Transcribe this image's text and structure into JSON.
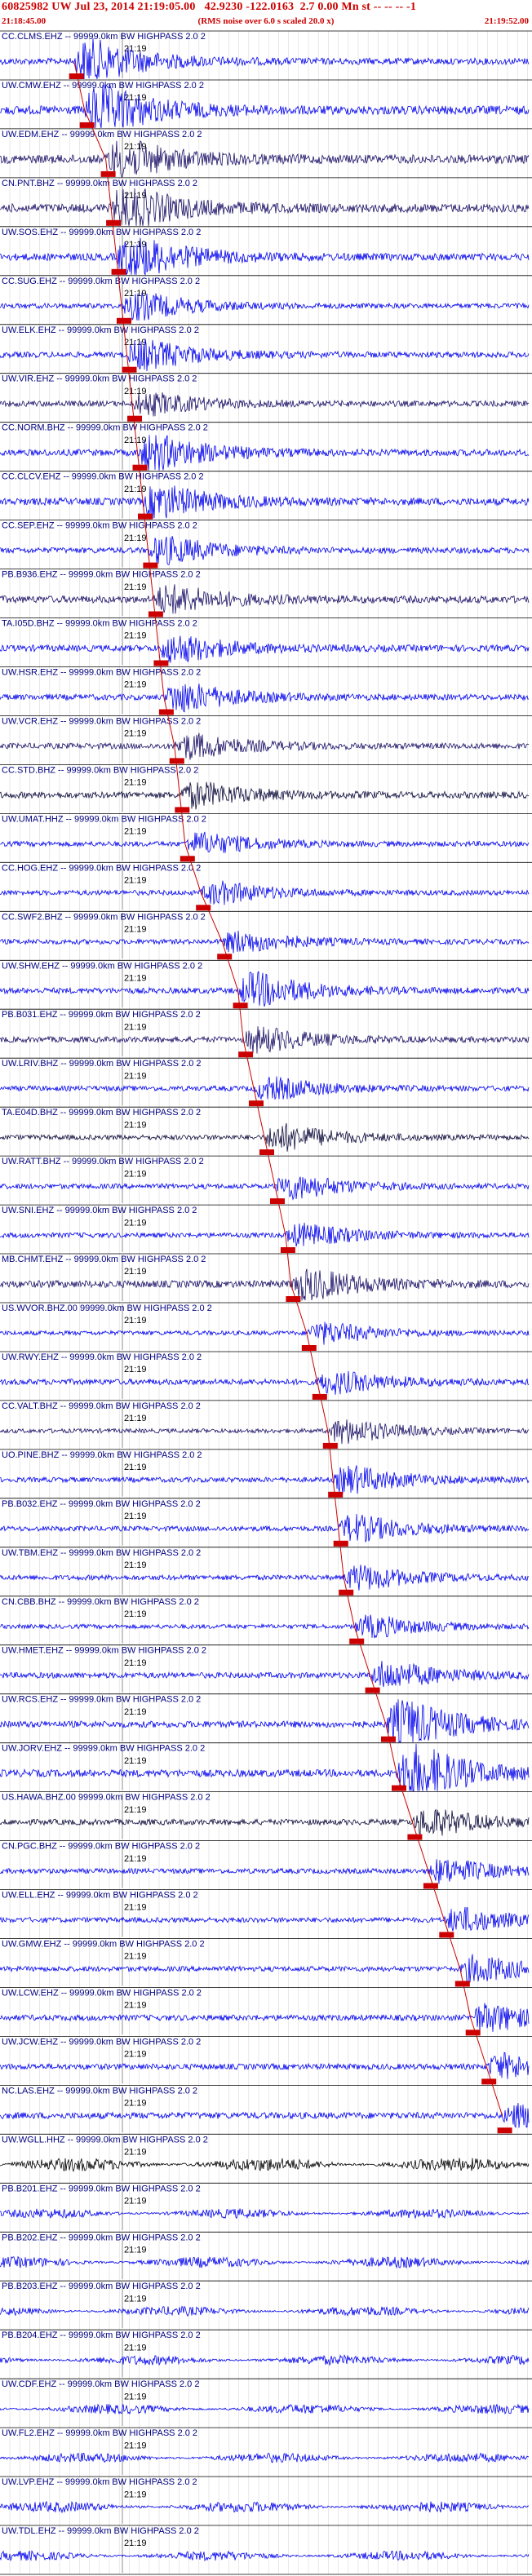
{
  "header": {
    "title": "60825982 UW Jul 23, 2014 21:19:05.00   42.9230 -122.0163  2.7 0.00 Mn st -- -- -- -1",
    "start_time": "21:18:45.00",
    "end_time": "21:19:52.00",
    "subtitle": "(RMS noise over 6.0 s scaled 20.0 x)"
  },
  "colors": {
    "trace": "#0000ee",
    "trace_dark": "#1a1066",
    "trace_darker": "#0b0a3a",
    "trace_black": "#000000",
    "pick_line": "#cc0000",
    "flag": "#cc0000",
    "label": "#000080"
  },
  "time_label": "21:19",
  "chart_data": {
    "type": "seismogram-stack",
    "x_axis": {
      "start": "21:18:45.00",
      "end": "21:19:52.00",
      "tick_label": "21:19"
    },
    "traces": [
      {
        "label": "CC.CLMS.EHZ -- 99999.0km BW  HIGHPASS  2.0  2",
        "color": "trace",
        "event_start": 0.14,
        "envelope": 0.45,
        "burst": 1.6
      },
      {
        "label": "UW.CMW.EHZ -- 99999.0km BW  HIGHPASS  2.0  2",
        "color": "trace",
        "event_start": 0.16,
        "envelope": 0.6,
        "burst": 1.8
      },
      {
        "label": "UW.EDM.EHZ -- 99999.0km BW  HIGHPASS  2.0  2",
        "color": "trace_dark",
        "event_start": 0.2,
        "envelope": 0.6,
        "burst": 1.4
      },
      {
        "label": "CN.PNT.BHZ -- 99999.0km BW  HIGHPASS  2.0  2",
        "color": "trace_dark",
        "event_start": 0.21,
        "envelope": 0.6,
        "burst": 1.5
      },
      {
        "label": "UW.SOS.EHZ -- 99999.0km BW  HIGHPASS  2.0  2",
        "color": "trace",
        "event_start": 0.22,
        "envelope": 0.5,
        "burst": 1.6
      },
      {
        "label": "CC.SUG.EHZ -- 99999.0km BW  HIGHPASS  2.0  2",
        "color": "trace",
        "event_start": 0.23,
        "envelope": 0.35,
        "burst": 1.0
      },
      {
        "label": "UW.ELK.EHZ -- 99999.0km BW  HIGHPASS  2.0  2",
        "color": "trace",
        "event_start": 0.24,
        "envelope": 0.4,
        "burst": 1.1
      },
      {
        "label": "UW.VIR.EHZ -- 99999.0km BW  HIGHPASS  2.0  2",
        "color": "trace_dark",
        "event_start": 0.25,
        "envelope": 0.4,
        "burst": 0.8
      },
      {
        "label": "CC.NORM.BHZ -- 99999.0km BW  HIGHPASS  2.0  2",
        "color": "trace",
        "event_start": 0.26,
        "envelope": 0.45,
        "burst": 1.3
      },
      {
        "label": "CC.CLCV.EHZ -- 99999.0km BW  HIGHPASS  2.0  2",
        "color": "trace",
        "event_start": 0.27,
        "envelope": 0.5,
        "burst": 1.2
      },
      {
        "label": "CC.SEP.EHZ -- 99999.0km BW  HIGHPASS  2.0  2",
        "color": "trace",
        "event_start": 0.28,
        "envelope": 0.4,
        "burst": 1.0
      },
      {
        "label": "PB.B936.EHZ -- 99999.0km BW  HIGHPASS  2.0  2",
        "color": "trace_dark",
        "event_start": 0.29,
        "envelope": 0.5,
        "burst": 1.0
      },
      {
        "label": "TA.I05D.BHZ -- 99999.0km BW  HIGHPASS  2.0  2",
        "color": "trace",
        "event_start": 0.3,
        "envelope": 0.45,
        "burst": 1.0
      },
      {
        "label": "UW.HSR.EHZ -- 99999.0km BW  HIGHPASS  2.0  2",
        "color": "trace",
        "event_start": 0.31,
        "envelope": 0.4,
        "burst": 1.1
      },
      {
        "label": "UW.VCR.EHZ -- 99999.0km BW  HIGHPASS  2.0  2",
        "color": "trace_dark",
        "event_start": 0.33,
        "envelope": 0.4,
        "burst": 0.9
      },
      {
        "label": "CC.STD.BHZ -- 99999.0km BW  HIGHPASS  2.0  2",
        "color": "trace_darker",
        "event_start": 0.34,
        "envelope": 0.45,
        "burst": 0.9
      },
      {
        "label": "UW.UMAT.HHZ -- 99999.0km BW  HIGHPASS  2.0  2",
        "color": "trace",
        "event_start": 0.35,
        "envelope": 0.35,
        "burst": 0.8
      },
      {
        "label": "CC.HOG.EHZ -- 99999.0km BW  HIGHPASS  2.0  2",
        "color": "trace",
        "event_start": 0.38,
        "envelope": 0.35,
        "burst": 0.8
      },
      {
        "label": "CC.SWF2.BHZ -- 99999.0km BW  HIGHPASS  2.0  2",
        "color": "trace",
        "event_start": 0.42,
        "envelope": 0.35,
        "burst": 0.8
      },
      {
        "label": "UW.SHW.EHZ -- 99999.0km BW  HIGHPASS  2.0  2",
        "color": "trace",
        "event_start": 0.45,
        "envelope": 0.4,
        "burst": 1.3
      },
      {
        "label": "PB.B031.EHZ -- 99999.0km BW  HIGHPASS  2.0  2",
        "color": "trace_dark",
        "event_start": 0.46,
        "envelope": 0.4,
        "burst": 0.9
      },
      {
        "label": "UW.LRIV.BHZ -- 99999.0km BW  HIGHPASS  2.0  2",
        "color": "trace",
        "event_start": 0.48,
        "envelope": 0.35,
        "burst": 0.8
      },
      {
        "label": "TA.E04D.BHZ -- 99999.0km BW  HIGHPASS  2.0  2",
        "color": "trace_darker",
        "event_start": 0.5,
        "envelope": 0.35,
        "burst": 1.0
      },
      {
        "label": "UW.RATT.BHZ -- 99999.0km BW  HIGHPASS  2.0  2",
        "color": "trace",
        "event_start": 0.52,
        "envelope": 0.35,
        "burst": 0.9
      },
      {
        "label": "UW.SNI.EHZ -- 99999.0km BW  HIGHPASS  2.0  2",
        "color": "trace",
        "event_start": 0.54,
        "envelope": 0.35,
        "burst": 0.8
      },
      {
        "label": "MB.CHMT.EHZ -- 99999.0km BW  HIGHPASS  2.0  2",
        "color": "trace_dark",
        "event_start": 0.55,
        "envelope": 0.5,
        "burst": 1.1
      },
      {
        "label": "US.WVOR.BHZ.00 99999.0km BW  HIGHPASS  2.0  2",
        "color": "trace",
        "event_start": 0.58,
        "envelope": 0.3,
        "burst": 0.8
      },
      {
        "label": "UW.RWY.EHZ -- 99999.0km BW  HIGHPASS  2.0  2",
        "color": "trace",
        "event_start": 0.6,
        "envelope": 0.4,
        "burst": 0.8
      },
      {
        "label": "CC.VALT.BHZ -- 99999.0km BW  HIGHPASS  2.0  2",
        "color": "trace_dark",
        "event_start": 0.62,
        "envelope": 0.3,
        "burst": 0.9
      },
      {
        "label": "UO.PINE.BHZ -- 99999.0km BW  HIGHPASS  2.0  2",
        "color": "trace",
        "event_start": 0.63,
        "envelope": 0.35,
        "burst": 1.0
      },
      {
        "label": "PB.B032.EHZ -- 99999.0km BW  HIGHPASS  2.0  2",
        "color": "trace",
        "event_start": 0.64,
        "envelope": 0.35,
        "burst": 1.0
      },
      {
        "label": "UW.TBM.EHZ -- 99999.0km BW  HIGHPASS  2.0  2",
        "color": "trace",
        "event_start": 0.65,
        "envelope": 0.35,
        "burst": 0.9
      },
      {
        "label": "CN.CBB.BHZ -- 99999.0km BW  HIGHPASS  2.0  2",
        "color": "trace",
        "event_start": 0.67,
        "envelope": 0.3,
        "burst": 0.8
      },
      {
        "label": "UW.HMET.EHZ -- 99999.0km BW  HIGHPASS  2.0  2",
        "color": "trace",
        "event_start": 0.7,
        "envelope": 0.4,
        "burst": 1.0
      },
      {
        "label": "UW.RCS.EHZ -- 99999.0km BW  HIGHPASS  2.0  2",
        "color": "trace",
        "event_start": 0.73,
        "envelope": 0.45,
        "burst": 1.8
      },
      {
        "label": "UW.JORV.EHZ -- 99999.0km BW  HIGHPASS  2.0  2",
        "color": "trace",
        "event_start": 0.75,
        "envelope": 0.5,
        "burst": 2.2
      },
      {
        "label": "US.HAWA.BHZ.00 99999.0km BW  HIGHPASS  2.0  2",
        "color": "trace_darker",
        "event_start": 0.78,
        "envelope": 0.4,
        "burst": 1.0
      },
      {
        "label": "CN.PGC.BHZ -- 99999.0km BW  HIGHPASS  2.0  2",
        "color": "trace",
        "event_start": 0.81,
        "envelope": 0.35,
        "burst": 0.9
      },
      {
        "label": "UW.ELL.EHZ -- 99999.0km BW  HIGHPASS  2.0  2",
        "color": "trace",
        "event_start": 0.84,
        "envelope": 0.35,
        "burst": 0.9
      },
      {
        "label": "UW.GMW.EHZ -- 99999.0km BW  HIGHPASS  2.0  2",
        "color": "trace",
        "event_start": 0.87,
        "envelope": 0.35,
        "burst": 1.0
      },
      {
        "label": "UW.LCW.EHZ -- 99999.0km BW  HIGHPASS  2.0  2",
        "color": "trace",
        "event_start": 0.89,
        "envelope": 0.4,
        "burst": 1.0
      },
      {
        "label": "UW.JCW.EHZ -- 99999.0km BW  HIGHPASS  2.0  2",
        "color": "trace",
        "event_start": 0.92,
        "envelope": 0.4,
        "burst": 0.9
      },
      {
        "label": "NC.LAS.EHZ -- 99999.0km BW  HIGHPASS  2.0  2",
        "color": "trace",
        "event_start": 0.95,
        "envelope": 0.45,
        "burst": 0.8
      },
      {
        "label": "UW.WGLL.HHZ -- 99999.0km BW  HIGHPASS  2.0  2",
        "color": "trace_black",
        "event_start": null,
        "envelope": 0.55,
        "burst": 0
      },
      {
        "label": "PB.B201.EHZ -- 99999.0km BW  HIGHPASS  2.0  2",
        "color": "trace",
        "event_start": null,
        "envelope": 0.4,
        "burst": 0
      },
      {
        "label": "PB.B202.EHZ -- 99999.0km BW  HIGHPASS  2.0  2",
        "color": "trace",
        "event_start": null,
        "envelope": 0.45,
        "burst": 0
      },
      {
        "label": "PB.B203.EHZ -- 99999.0km BW  HIGHPASS  2.0  2",
        "color": "trace",
        "event_start": null,
        "envelope": 0.4,
        "burst": 0
      },
      {
        "label": "PB.B204.EHZ -- 99999.0km BW  HIGHPASS  2.0  2",
        "color": "trace",
        "event_start": null,
        "envelope": 0.4,
        "burst": 0
      },
      {
        "label": "UW.CDF.EHZ -- 99999.0km BW  HIGHPASS  2.0  2",
        "color": "trace",
        "event_start": null,
        "envelope": 0.4,
        "burst": 0
      },
      {
        "label": "UW.FL2.EHZ -- 99999.0km BW  HIGHPASS  2.0  2",
        "color": "trace",
        "event_start": null,
        "envelope": 0.4,
        "burst": 0
      },
      {
        "label": "UW.LVP.EHZ -- 99999.0km BW  HIGHPASS  2.0  2",
        "color": "trace",
        "event_start": null,
        "envelope": 0.45,
        "burst": 0
      },
      {
        "label": "UW.TDL.EHZ -- 99999.0km BW  HIGHPASS  2.0  2",
        "color": "trace",
        "event_start": null,
        "envelope": 0.4,
        "burst": 0
      }
    ]
  }
}
